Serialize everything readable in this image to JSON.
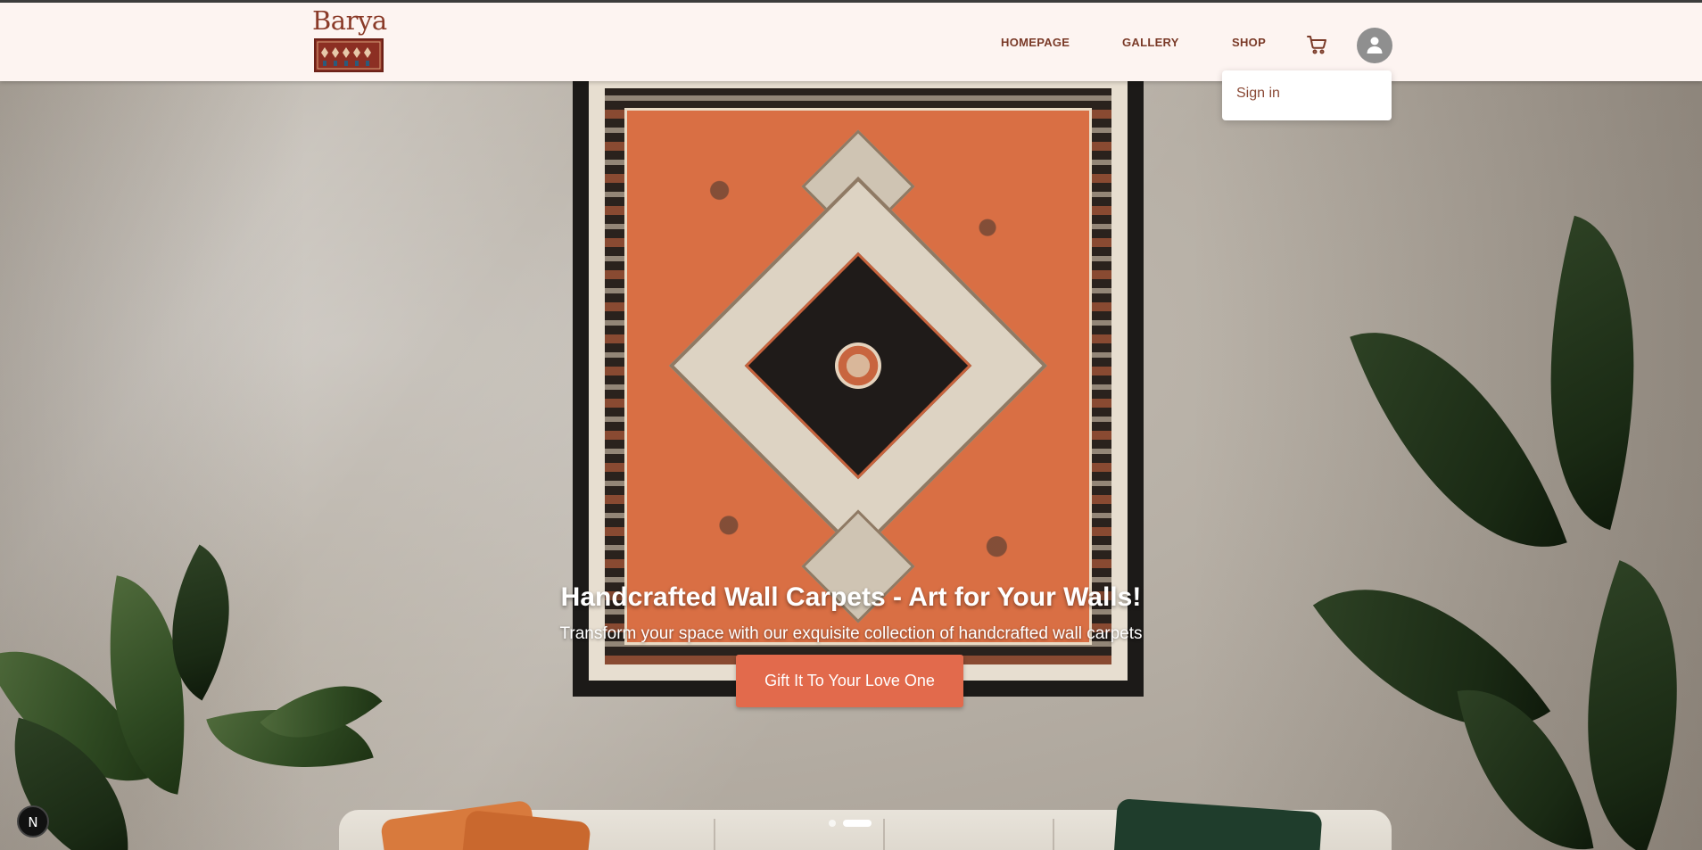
{
  "header": {
    "logo_text": "Barya",
    "nav": {
      "homepage": "HOMEPAGE",
      "gallery": "GALLERY",
      "shop": "SHOP"
    },
    "cart_icon": "shopping-cart-icon",
    "account_icon": "user-icon"
  },
  "account_menu": {
    "sign_in": "Sign in"
  },
  "hero": {
    "title": "Handcrafted Wall Carpets - Art for Your Walls!",
    "subtitle": "Transform your space with our exquisite collection of handcrafted wall carpets",
    "cta_label": "Gift It To Your Love One",
    "slides": {
      "count": 2,
      "active_index": 1
    }
  },
  "dev_badge": {
    "label": "N"
  },
  "colors": {
    "header_bg": "#fdf4f1",
    "nav_text": "#7a3a28",
    "cta_bg": "#e26a4c",
    "avatar_bg": "#8f8f8f"
  }
}
